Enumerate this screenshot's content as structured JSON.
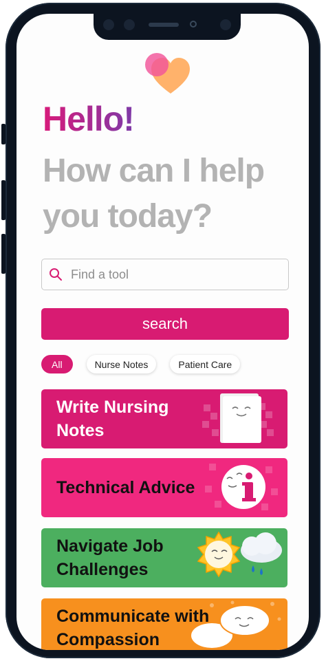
{
  "greeting": "Hello!",
  "prompt": "How can I help you today?",
  "search": {
    "placeholder": "Find a tool",
    "button_label": "search"
  },
  "filters": [
    {
      "label": "All",
      "active": true
    },
    {
      "label": "Nurse Notes",
      "active": false
    },
    {
      "label": "Patient Care",
      "active": false
    }
  ],
  "tools": [
    {
      "label": "Write Nursing Notes",
      "color": "#d81b72",
      "text_color": "#ffffff",
      "icon": "notepad-icon"
    },
    {
      "label": "Technical Advice",
      "color": "#f0287f",
      "text_color": "#111111",
      "icon": "info-icon"
    },
    {
      "label": "Navigate Job Challenges",
      "color": "#4caf5f",
      "text_color": "#111111",
      "icon": "sun-cloud-icon"
    },
    {
      "label": "Communicate with Compassion",
      "color": "#f7901e",
      "text_color": "#111111",
      "icon": "speech-bubbles-icon"
    }
  ],
  "colors": {
    "accent": "#d81b72",
    "heading_gray": "#b3b3b3"
  }
}
